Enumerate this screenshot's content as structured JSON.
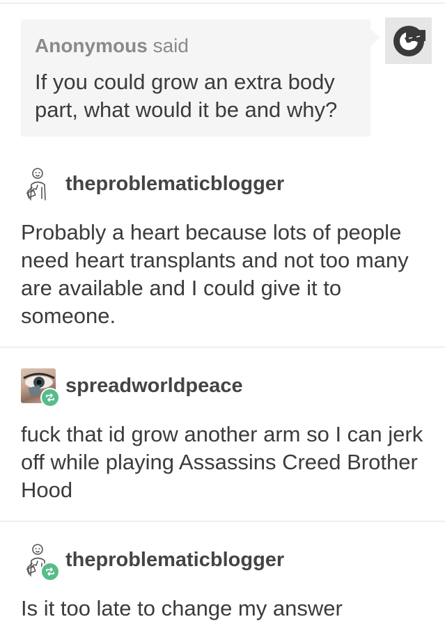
{
  "ask": {
    "asker": "Anonymous",
    "said": "said",
    "question": "If you could grow an extra body part, what would it be and why?",
    "avatar_icon": "sunglasses-face-icon"
  },
  "posts": [
    {
      "username": "theproblematicblogger",
      "avatar_icon": "thinking-person-icon",
      "reblogged": false,
      "text": "Probably a heart because lots of people need heart transplants and not too many are available and I could give it to someone."
    },
    {
      "username": "spreadworldpeace",
      "avatar_icon": "eye-photo-avatar",
      "reblogged": true,
      "text": "fuck that id grow another arm so I can jerk off while playing Assassins Creed Brother Hood"
    },
    {
      "username": "theproblematicblogger",
      "avatar_icon": "thinking-person-icon",
      "reblogged": true,
      "text": "Is it too late to change my answer"
    }
  ],
  "colors": {
    "ask_background": "#f5f5f5",
    "reblog_badge": "#56bc8a",
    "divider": "#e2e2e2",
    "text": "#3b3b3b"
  }
}
